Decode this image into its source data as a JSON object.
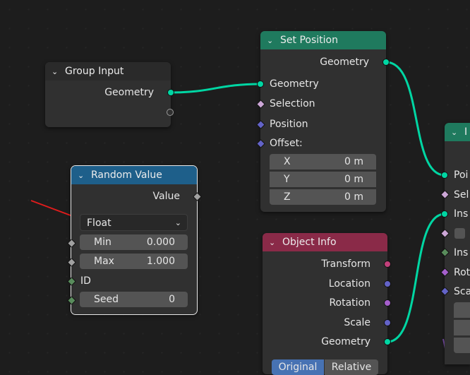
{
  "nodes": {
    "group_input": {
      "title": "Group Input",
      "outputs": [
        "Geometry"
      ]
    },
    "set_position": {
      "title": "Set Position",
      "output": "Geometry",
      "inputs": {
        "geometry": "Geometry",
        "selection": "Selection",
        "position": "Position",
        "offset": "Offset:"
      },
      "offset": [
        {
          "axis": "X",
          "value": "0 m"
        },
        {
          "axis": "Y",
          "value": "0 m"
        },
        {
          "axis": "Z",
          "value": "0 m"
        }
      ]
    },
    "random_value": {
      "title": "Random Value",
      "output": "Value",
      "data_type": "Float",
      "min_label": "Min",
      "min_value": "0.000",
      "max_label": "Max",
      "max_value": "1.000",
      "id_label": "ID",
      "seed_label": "Seed",
      "seed_value": "0"
    },
    "object_info": {
      "title": "Object Info",
      "outputs": [
        "Transform",
        "Location",
        "Rotation",
        "Scale",
        "Geometry"
      ],
      "tabs": [
        "Original",
        "Relative"
      ]
    },
    "instance_on_points": {
      "title": "I",
      "inputs": [
        "Poi",
        "Sel",
        "Ins",
        "",
        "Ins",
        "Rot",
        "Sca"
      ]
    }
  },
  "colors": {
    "geometry_socket": "#00d6a3",
    "set_position_header": "#1f7a5e",
    "random_value_header": "#1e5f8a",
    "object_info_header": "#8a2a48",
    "annotation_arrow": "#e01c1c"
  },
  "icons": [
    "chevron-down-icon",
    "annotation-arrow"
  ]
}
